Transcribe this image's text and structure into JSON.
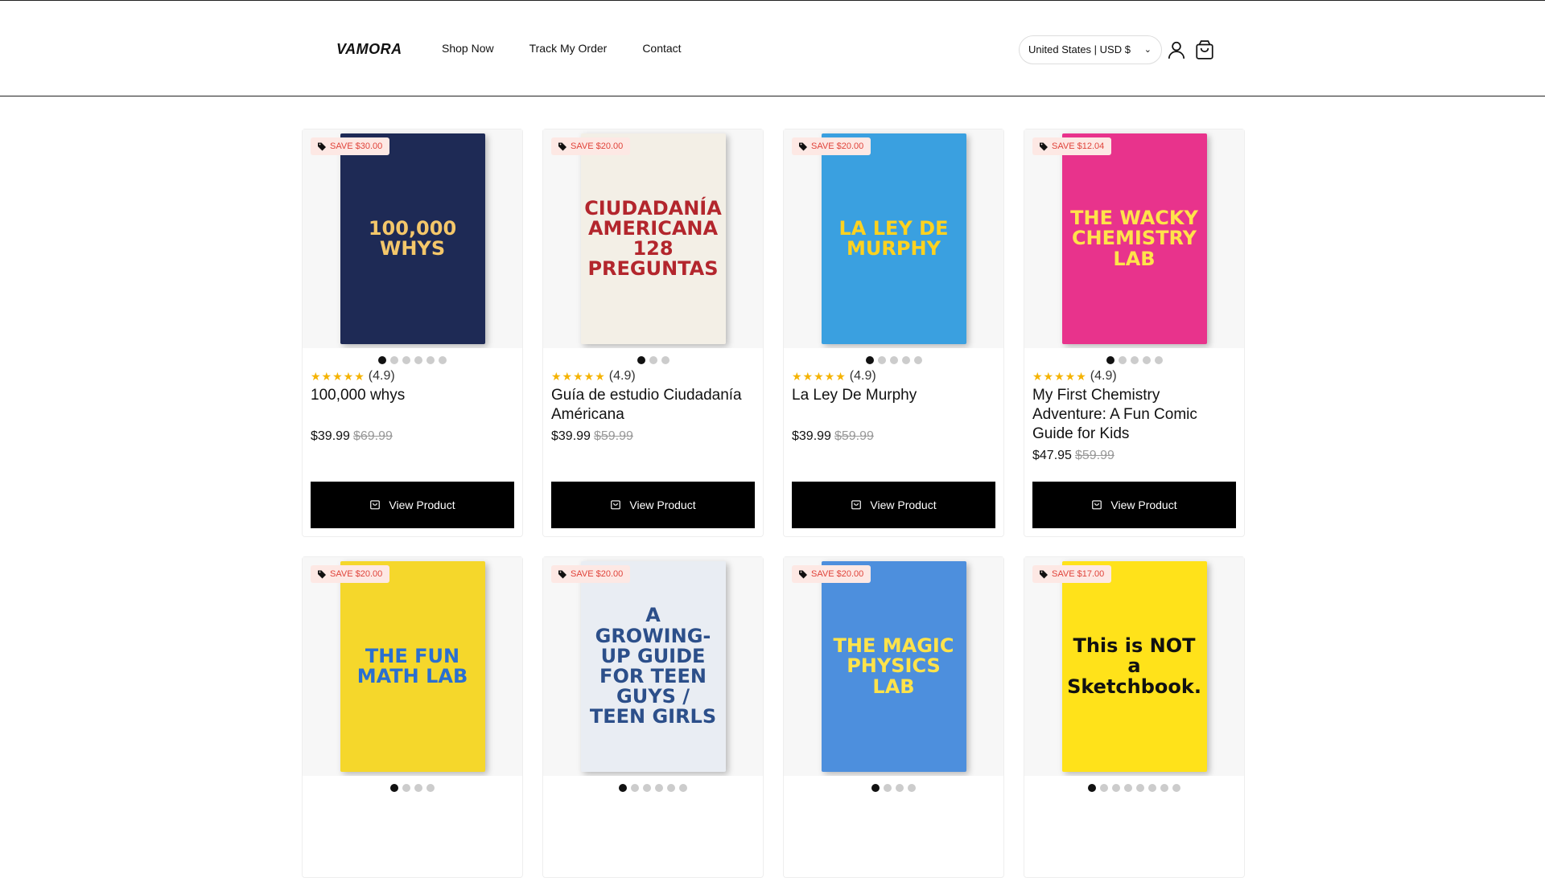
{
  "header": {
    "logo": "VAMORA",
    "nav": [
      "Shop Now",
      "Track My Order",
      "Contact"
    ],
    "currency": "United States | USD $"
  },
  "products": [
    {
      "badge": "SAVE $30.00",
      "cover_text": "100,000 WHYS",
      "cover_bg": "#1e2a55",
      "cover_fg": "#f4c76a",
      "dots": 6,
      "rating": "(4.9)",
      "title": "100,000 whys",
      "price": "$39.99",
      "old_price": "$69.99",
      "button": "View Product"
    },
    {
      "badge": "SAVE $20.00",
      "cover_text": "CIUDADANÍA AMERICANA 128 PREGUNTAS",
      "cover_bg": "#f3efe6",
      "cover_fg": "#b3262d",
      "dots": 3,
      "rating": "(4.9)",
      "title": "Guía de estudio Ciudadanía Américana",
      "price": "$39.99",
      "old_price": "$59.99",
      "button": "View Product"
    },
    {
      "badge": "SAVE $20.00",
      "cover_text": "LA LEY DE MURPHY",
      "cover_bg": "#3aa0e0",
      "cover_fg": "#ffd21f",
      "dots": 5,
      "rating": "(4.9)",
      "title": "La Ley De Murphy",
      "price": "$39.99",
      "old_price": "$59.99",
      "button": "View Product"
    },
    {
      "badge": "SAVE $12.04",
      "cover_text": "THE WACKY CHEMISTRY LAB",
      "cover_bg": "#e8338c",
      "cover_fg": "#ffe34a",
      "dots": 5,
      "rating": "(4.9)",
      "title": "My First Chemistry Adventure: A Fun Comic Guide for Kids",
      "price": "$47.95",
      "old_price": "$59.99",
      "button": "View Product"
    },
    {
      "badge": "SAVE $20.00",
      "cover_text": "THE FUN MATH LAB",
      "cover_bg": "#f5d72b",
      "cover_fg": "#2a6fd1",
      "dots": 4
    },
    {
      "badge": "SAVE $20.00",
      "cover_text": "A GROWING-UP GUIDE FOR TEEN GUYS / TEEN GIRLS",
      "cover_bg": "#e9edf3",
      "cover_fg": "#2c4f8a",
      "dots": 6
    },
    {
      "badge": "SAVE $20.00",
      "cover_text": "THE MAGIC PHYSICS LAB",
      "cover_bg": "#4d8fdd",
      "cover_fg": "#ffe34a",
      "dots": 4
    },
    {
      "badge": "SAVE $17.00",
      "cover_text": "This is NOT a Sketchbook.",
      "cover_bg": "#ffe21a",
      "cover_fg": "#111111",
      "dots": 8
    }
  ]
}
